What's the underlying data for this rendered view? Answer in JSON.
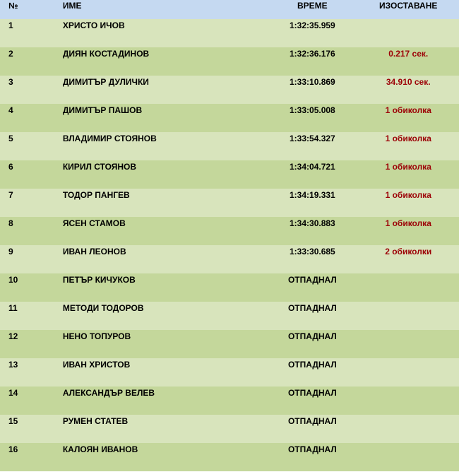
{
  "header": {
    "pos": "№",
    "name": "ИМЕ",
    "time": "ВРЕМЕ",
    "gap": "ИЗОСТАВАНЕ"
  },
  "rows": [
    {
      "pos": "1",
      "name": "ХРИСТО ИЧОВ",
      "time": "1:32:35.959",
      "gap": ""
    },
    {
      "pos": "2",
      "name": "ДИЯН КОСТАДИНОВ",
      "time": "1:32:36.176",
      "gap": "0.217 сек."
    },
    {
      "pos": "3",
      "name": "ДИМИТЪР ДУЛИЧКИ",
      "time": "1:33:10.869",
      "gap": "34.910 сек."
    },
    {
      "pos": "4",
      "name": "ДИМИТЪР ПАШОВ",
      "time": "1:33:05.008",
      "gap": "1 обиколка"
    },
    {
      "pos": "5",
      "name": "ВЛАДИМИР СТОЯНОВ",
      "time": "1:33:54.327",
      "gap": "1 обиколка"
    },
    {
      "pos": "6",
      "name": "КИРИЛ СТОЯНОВ",
      "time": "1:34:04.721",
      "gap": "1 обиколка"
    },
    {
      "pos": "7",
      "name": "ТОДОР ПАНГЕВ",
      "time": "1:34:19.331",
      "gap": "1 обиколка"
    },
    {
      "pos": "8",
      "name": "ЯСЕН СТАМОВ",
      "time": "1:34:30.883",
      "gap": "1 обиколка"
    },
    {
      "pos": "9",
      "name": "ИВАН ЛЕОНОВ",
      "time": "1:33:30.685",
      "gap": "2 обиколки"
    },
    {
      "pos": "10",
      "name": "ПЕТЪР КИЧУКОВ",
      "time": "ОТПАДНАЛ",
      "gap": ""
    },
    {
      "pos": "11",
      "name": "МЕТОДИ ТОДОРОВ",
      "time": "ОТПАДНАЛ",
      "gap": ""
    },
    {
      "pos": "12",
      "name": "НЕНО ТОПУРОВ",
      "time": "ОТПАДНАЛ",
      "gap": ""
    },
    {
      "pos": "13",
      "name": "ИВАН ХРИСТОВ",
      "time": "ОТПАДНАЛ",
      "gap": ""
    },
    {
      "pos": "14",
      "name": "АЛЕКСАНДЪР ВЕЛЕВ",
      "time": "ОТПАДНАЛ",
      "gap": ""
    },
    {
      "pos": "15",
      "name": "РУМЕН СТАТЕВ",
      "time": "ОТПАДНАЛ",
      "gap": ""
    },
    {
      "pos": "16",
      "name": "КАЛОЯН ИВАНОВ",
      "time": "ОТПАДНАЛ",
      "gap": ""
    }
  ],
  "colors": {
    "header_bg": "#c5d9f1",
    "row_light": "#d8e4bc",
    "row_dark": "#c4d79b",
    "gap_text": "#9c0006"
  }
}
